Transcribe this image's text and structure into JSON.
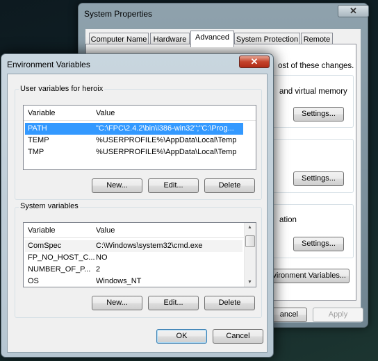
{
  "system_properties": {
    "title": "System Properties",
    "tabs": [
      "Computer Name",
      "Hardware",
      "Advanced",
      "System Protection",
      "Remote"
    ],
    "active_tab": "Advanced",
    "visible_text": {
      "admin_note": "ost of these changes.",
      "performance_desc": "and virtual memory",
      "startup_desc": "ation"
    },
    "settings_label": "Settings...",
    "env_vars_button": "vironment Variables...",
    "cancel_button": "ancel",
    "apply_button": "Apply"
  },
  "env_dialog": {
    "title": "Environment Variables",
    "user_group": {
      "label": "User variables for heroix",
      "columns": [
        "Variable",
        "Value"
      ],
      "rows": [
        {
          "variable": "PATH",
          "value": "\"C:\\FPC\\2.4.2\\bin\\i386-win32\";\"C:\\Prog...",
          "selected": true
        },
        {
          "variable": "TEMP",
          "value": "%USERPROFILE%\\AppData\\Local\\Temp"
        },
        {
          "variable": "TMP",
          "value": "%USERPROFILE%\\AppData\\Local\\Temp"
        }
      ],
      "buttons": {
        "new": "New...",
        "edit": "Edit...",
        "delete": "Delete"
      }
    },
    "system_group": {
      "label": "System variables",
      "columns": [
        "Variable",
        "Value"
      ],
      "rows": [
        {
          "variable": "ComSpec",
          "value": "C:\\Windows\\system32\\cmd.exe"
        },
        {
          "variable": "FP_NO_HOST_C...",
          "value": "NO"
        },
        {
          "variable": "NUMBER_OF_P...",
          "value": "2"
        },
        {
          "variable": "OS",
          "value": "Windows_NT"
        }
      ],
      "buttons": {
        "new": "New...",
        "edit": "Edit...",
        "delete": "Delete"
      }
    },
    "ok": "OK",
    "cancel": "Cancel"
  },
  "colors": {
    "selection": "#3399ff",
    "close_red": "#c4432b"
  }
}
